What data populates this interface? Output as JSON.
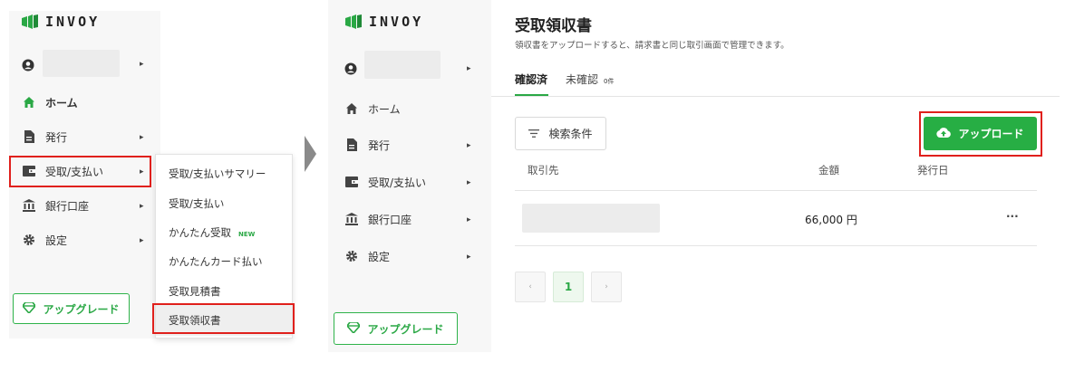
{
  "brand": {
    "name": "INVOY",
    "color": "#2aa845"
  },
  "left": {
    "nav": [
      {
        "icon": "home-icon",
        "label": "ホーム"
      },
      {
        "icon": "document-icon",
        "label": "発行"
      },
      {
        "icon": "wallet-icon",
        "label": "受取/支払い"
      },
      {
        "icon": "bank-icon",
        "label": "銀行口座"
      },
      {
        "icon": "gear-icon",
        "label": "設定"
      }
    ],
    "upgrade_label": "アップグレード",
    "dropdown": [
      {
        "label": "受取/支払いサマリー"
      },
      {
        "label": "受取/支払い"
      },
      {
        "label": "かんたん受取",
        "badge": "NEW"
      },
      {
        "label": "かんたんカード払い"
      },
      {
        "label": "受取見積書"
      },
      {
        "label": "受取領収書"
      }
    ]
  },
  "right": {
    "nav": [
      {
        "label": "ホーム"
      },
      {
        "label": "発行"
      },
      {
        "label": "受取/支払い"
      },
      {
        "label": "銀行口座"
      },
      {
        "label": "設定"
      }
    ],
    "upgrade_label": "アップグレード",
    "page_title": "受取領収書",
    "page_subtitle": "領収書をアップロードすると、請求書と同じ取引画面で管理できます。",
    "tabs": [
      {
        "label": "確認済",
        "active": true
      },
      {
        "label": "未確認",
        "count": "0件"
      }
    ],
    "filter_label": "検索条件",
    "upload_label": "アップロード",
    "table": {
      "headers": [
        "取引先",
        "金額",
        "発行日"
      ],
      "rows": [
        {
          "partner": "",
          "amount": "66,000 円",
          "date": "",
          "menu": "···"
        }
      ]
    },
    "pagination": {
      "prev": "‹",
      "current": "1",
      "next": "›"
    }
  }
}
